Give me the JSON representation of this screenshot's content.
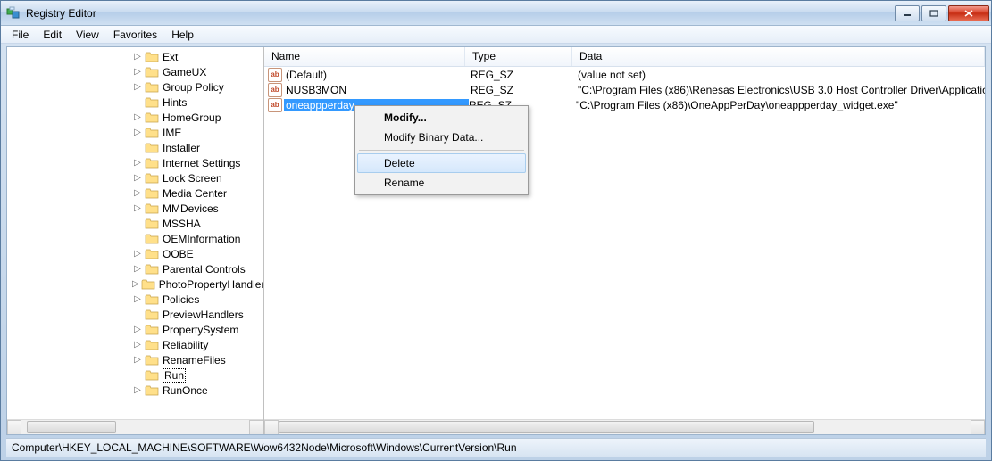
{
  "title": "Registry Editor",
  "menu": {
    "file": "File",
    "edit": "Edit",
    "view": "View",
    "favorites": "Favorites",
    "help": "Help"
  },
  "tree": {
    "items": [
      {
        "label": "Ext",
        "expandable": true
      },
      {
        "label": "GameUX",
        "expandable": true
      },
      {
        "label": "Group Policy",
        "expandable": true
      },
      {
        "label": "Hints",
        "expandable": false
      },
      {
        "label": "HomeGroup",
        "expandable": true
      },
      {
        "label": "IME",
        "expandable": true
      },
      {
        "label": "Installer",
        "expandable": false
      },
      {
        "label": "Internet Settings",
        "expandable": true
      },
      {
        "label": "Lock Screen",
        "expandable": true
      },
      {
        "label": "Media Center",
        "expandable": true
      },
      {
        "label": "MMDevices",
        "expandable": true
      },
      {
        "label": "MSSHA",
        "expandable": false
      },
      {
        "label": "OEMInformation",
        "expandable": false
      },
      {
        "label": "OOBE",
        "expandable": true
      },
      {
        "label": "Parental Controls",
        "expandable": true
      },
      {
        "label": "PhotoPropertyHandler",
        "expandable": true
      },
      {
        "label": "Policies",
        "expandable": true
      },
      {
        "label": "PreviewHandlers",
        "expandable": false
      },
      {
        "label": "PropertySystem",
        "expandable": true
      },
      {
        "label": "Reliability",
        "expandable": true
      },
      {
        "label": "RenameFiles",
        "expandable": true
      },
      {
        "label": "Run",
        "expandable": false,
        "selected": true
      },
      {
        "label": "RunOnce",
        "expandable": true
      }
    ]
  },
  "columns": {
    "name": "Name",
    "type": "Type",
    "data": "Data"
  },
  "values": [
    {
      "name": "(Default)",
      "type": "REG_SZ",
      "data": "(value not set)"
    },
    {
      "name": "NUSB3MON",
      "type": "REG_SZ",
      "data": "\"C:\\Program Files (x86)\\Renesas Electronics\\USB 3.0 Host Controller Driver\\Applicatio"
    },
    {
      "name": "oneappperday",
      "type": "REG_SZ",
      "data": "\"C:\\Program Files (x86)\\OneAppPerDay\\oneappperday_widget.exe\"",
      "selected": true
    }
  ],
  "context_menu": {
    "modify": "Modify...",
    "modify_binary": "Modify Binary Data...",
    "delete": "Delete",
    "rename": "Rename"
  },
  "statusbar": "Computer\\HKEY_LOCAL_MACHINE\\SOFTWARE\\Wow6432Node\\Microsoft\\Windows\\CurrentVersion\\Run"
}
